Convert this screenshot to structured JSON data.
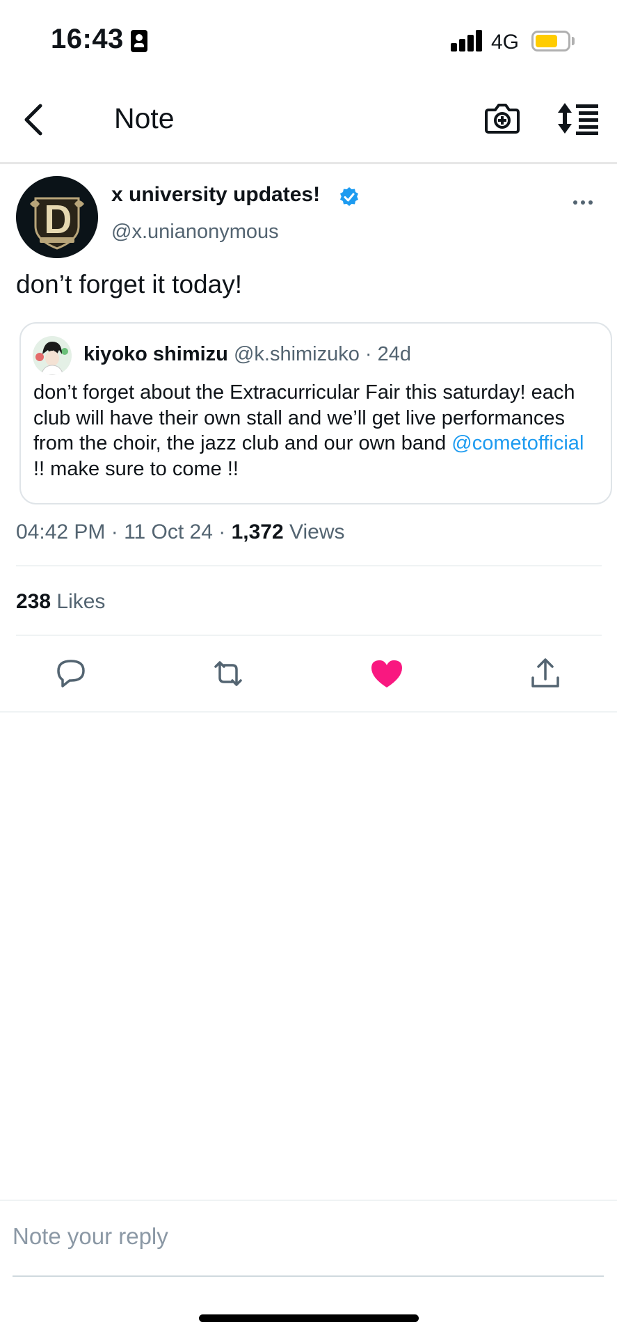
{
  "status_bar": {
    "time": "16:43",
    "network": "4G",
    "battery_level": 0.7
  },
  "header": {
    "title": "Note"
  },
  "post": {
    "author_name": "x university updates!",
    "author_handle": "@x.unianonymous",
    "text": "don’t forget it today!",
    "quote": {
      "author_name": "kiyoko shimizu",
      "meta": "@k.shimizuko · 24d",
      "text_before": "don’t forget about the Extracurricular Fair this saturday! each club will have their own stall and we’ll get live performances from the choir, the jazz club and our own band ",
      "mention": "@cometofficial",
      "text_after": " !! make sure to come !!"
    },
    "timestamp": "04:42 PM · 11 Oct 24 · ",
    "views_count": "1,372",
    "views_label": " Views",
    "likes_count": "238",
    "likes_label": " Likes"
  },
  "icons": {
    "back": "chevron-left-icon",
    "camera": "camera-plus-icon",
    "sort": "sort-order-icon",
    "more": "more-dots-icon",
    "reply": "comment-icon",
    "retweet": "retweet-icon",
    "like": "heart-filled-icon",
    "share": "share-icon"
  },
  "colors": {
    "accent": "#1d9bf0",
    "like": "#f91880",
    "muted": "#536471"
  },
  "reply_bar": {
    "placeholder": "Note your reply"
  }
}
